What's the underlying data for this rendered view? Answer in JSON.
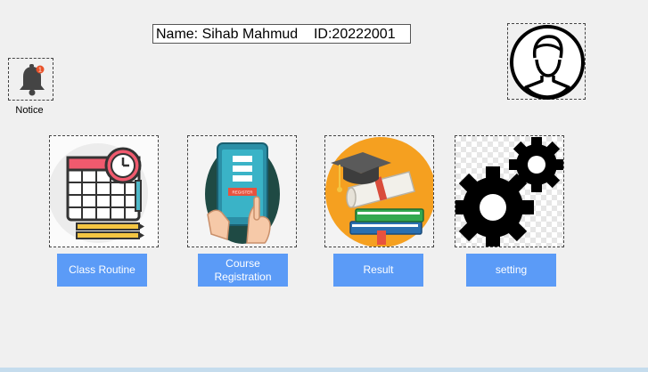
{
  "header": {
    "name_id": "Name: Sihab Mahmud    ID:20222001"
  },
  "notice": {
    "label": "Notice",
    "badge_count": "1",
    "icon": "bell-icon"
  },
  "profile": {
    "icon": "user-avatar-icon"
  },
  "tiles": [
    {
      "icon": "calendar-clock-icon",
      "label": "Class Routine"
    },
    {
      "icon": "tablet-registration-icon",
      "label": "Course Registration",
      "screen_text": "REGISTER"
    },
    {
      "icon": "graduation-books-icon",
      "label": "Result"
    },
    {
      "icon": "gears-icon",
      "label": "setting"
    }
  ],
  "colors": {
    "button": "#5b9bf7",
    "background": "#f0f0f0"
  }
}
